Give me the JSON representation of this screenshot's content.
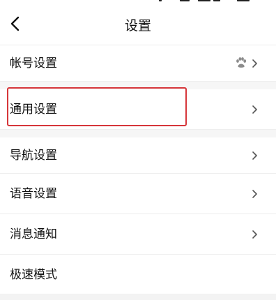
{
  "header": {
    "title": "设置"
  },
  "settings": {
    "items": [
      {
        "label": "帐号设置"
      },
      {
        "label": "通用设置"
      },
      {
        "label": "导航设置"
      },
      {
        "label": "语音设置"
      },
      {
        "label": "消息通知"
      },
      {
        "label": "极速模式"
      }
    ]
  },
  "icons": {
    "back": "chevron-left-icon",
    "account": "paw-icon",
    "row_arrow": "chevron-right-icon"
  },
  "colors": {
    "highlight": "#d6363a",
    "text": "#111111",
    "divider": "#eeeeee",
    "chevron": "#555555"
  }
}
